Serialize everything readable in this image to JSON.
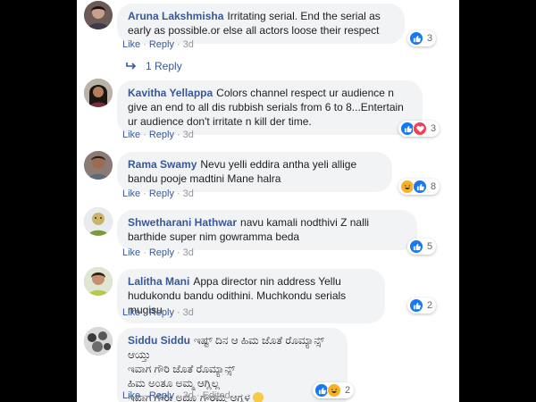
{
  "comments": [
    {
      "author": "Aruna Lakshmisha",
      "text": "Irritating serial. End the serial as early as possible.or else all actors loose their respect",
      "like": "Like",
      "reply": "Reply",
      "time": "3d",
      "reaction_count": "3",
      "reactions": [
        "like"
      ]
    },
    {
      "author": "Kavitha Yellappa",
      "text": "Colors channel respect ur audience n give an end to all dis rubbish serials from 6 to 8...Entertain ur audience don't irritate n kill der time.",
      "like": "Like",
      "reply": "Reply",
      "time": "3d",
      "reaction_count": "3",
      "reactions": [
        "like",
        "love"
      ]
    },
    {
      "author": "Rama Swamy",
      "text": "Nevu yelli eddira antha yeli allige bandu pooje madtini Mane halra",
      "like": "Like",
      "reply": "Reply",
      "time": "3d",
      "reaction_count": "8",
      "reactions": [
        "haha",
        "like"
      ]
    },
    {
      "author": "Shwetharani Hathwar",
      "text": "navu kamali nodthivi Z nalli barthide super nim gowramma beda",
      "like": "Like",
      "reply": "Reply",
      "time": "3d",
      "reaction_count": "5",
      "reactions": [
        "like"
      ]
    },
    {
      "author": "Lalitha Mani",
      "text": "Appa director nin address Yellu hudukondu bandu odithini. Muchkondu serials mugisu",
      "like": "Like",
      "reply": "Reply",
      "time": "3d",
      "reaction_count": "2",
      "reactions": [
        "like"
      ]
    },
    {
      "author": "Siddu Siddu",
      "text": "ಇಷ್ಟ್ ದಿನ ಆ ಹಿಮ ಜೊತೆ ರೊಮ್ಯಾನ್ಸ್ ಆಯ್ತು",
      "line2": "ಇವಾಗ ಗೌರಿ ಜೊತೆ ರೊಮ್ಯಾನ್ಸ್",
      "line3": "ಹಿಮ ಅಂತೂ ಅಮ್ಮ ಆಗ್ಲಿಲ್ಲ",
      "line4": "ಇವಾಗ ಗೌರೀ ಅದ್ರೂ ಗೌರಮ್ಮ ಆಗ್ಲಳ",
      "like": "Like",
      "reply": "Reply",
      "time": "3d",
      "edited": "Edited",
      "reaction_count": "2",
      "reactions": [
        "like",
        "haha"
      ]
    }
  ],
  "replies_link": "1 Reply",
  "colors": {
    "author": "#385898",
    "bubble": "#f2f3f5",
    "like": "#1877f2",
    "love": "#f33e58",
    "haha": "#f7b125"
  }
}
